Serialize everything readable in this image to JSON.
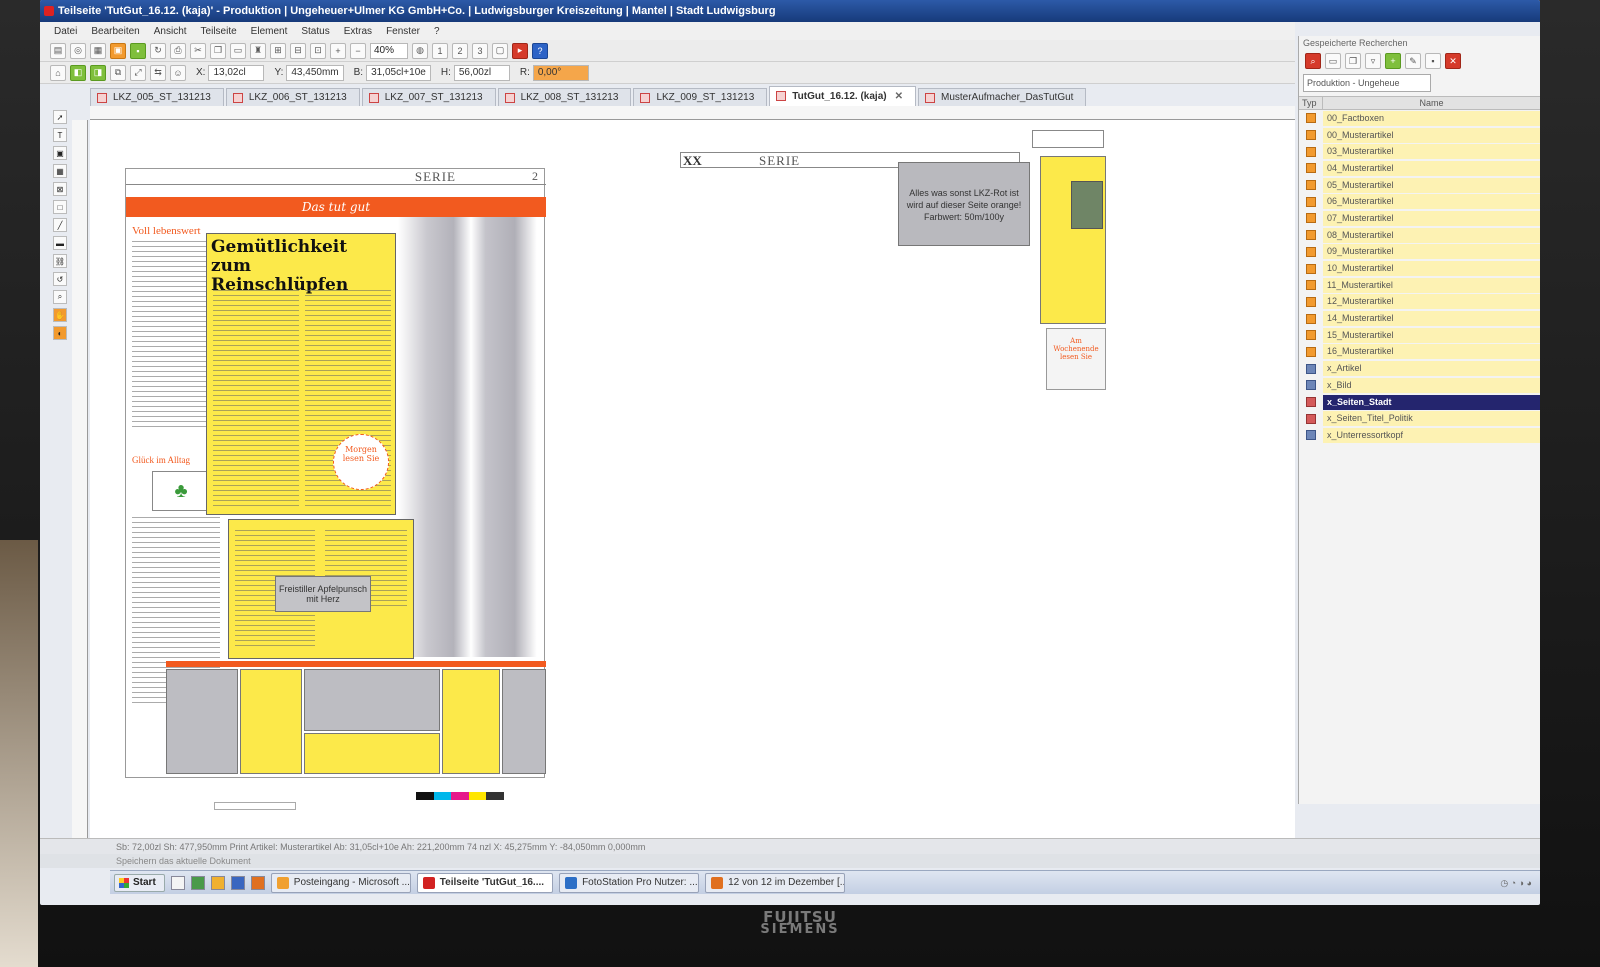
{
  "window": {
    "title": "Teilseite 'TutGut_16.12. (kaja)' - Produktion | Ungeheuer+Ulmer KG GmbH+Co. | Ludwigsburger Kreiszeitung | Mantel | Stadt Ludwigsburg"
  },
  "menu": [
    "Datei",
    "Bearbeiten",
    "Ansicht",
    "Teilseite",
    "Element",
    "Status",
    "Extras",
    "Fenster",
    "?"
  ],
  "toolbar": {
    "zoom": "40%",
    "x_label": "X:",
    "x_value": "13,02cl",
    "y_label": "Y:",
    "y_value": "43,450mm",
    "b_label": "B:",
    "b_value": "31,05cl+10e",
    "h_label": "H:",
    "h_value": "56,00zl",
    "r_label": "R:",
    "r_value": "0,00°"
  },
  "tabs": [
    {
      "label": "LKZ_005_ST_131213",
      "active": false
    },
    {
      "label": "LKZ_006_ST_131213",
      "active": false
    },
    {
      "label": "LKZ_007_ST_131213",
      "active": false
    },
    {
      "label": "LKZ_008_ST_131213",
      "active": false
    },
    {
      "label": "LKZ_009_ST_131213",
      "active": false
    },
    {
      "label": "TutGut_16.12. (kaja)",
      "active": true
    },
    {
      "label": "MusterAufmacher_DasTutGut",
      "active": false
    }
  ],
  "page": {
    "serie": "SERIE",
    "page_no": "2",
    "banner": "Das tut gut",
    "kicker": "Voll lebenswert",
    "headline_1": "Gemütlichkeit",
    "headline_2": "zum Reinschlüpfen",
    "stamp": "Morgen lesen Sie",
    "left_sub": "Glück im Alltag",
    "placeholder_text": "Freistiller Apfelpunsch mit Herz"
  },
  "page2": {
    "xx": "XX",
    "serie": "SERIE",
    "note": "Alles was sonst LKZ-Rot ist wird auf dieser Seite orange! Farbwert: 50m/100y",
    "stamp": "Am Wochenende lesen Sie"
  },
  "right_panel": {
    "title": "Gespeicherte Recherchen",
    "select": "Produktion - Ungeheue",
    "col_typ": "Typ",
    "col_name": "Name",
    "items": [
      {
        "label": "00_Factboxen",
        "type": "orange"
      },
      {
        "label": "00_Musterartikel",
        "type": "orange"
      },
      {
        "label": "03_Musterartikel",
        "type": "orange"
      },
      {
        "label": "04_Musterartikel",
        "type": "orange"
      },
      {
        "label": "05_Musterartikel",
        "type": "orange"
      },
      {
        "label": "06_Musterartikel",
        "type": "orange"
      },
      {
        "label": "07_Musterartikel",
        "type": "orange"
      },
      {
        "label": "08_Musterartikel",
        "type": "orange"
      },
      {
        "label": "09_Musterartikel",
        "type": "orange"
      },
      {
        "label": "10_Musterartikel",
        "type": "orange"
      },
      {
        "label": "11_Musterartikel",
        "type": "orange"
      },
      {
        "label": "12_Musterartikel",
        "type": "orange"
      },
      {
        "label": "14_Musterartikel",
        "type": "orange"
      },
      {
        "label": "15_Musterartikel",
        "type": "orange"
      },
      {
        "label": "16_Musterartikel",
        "type": "orange"
      },
      {
        "label": "x_Artikel",
        "type": "blue"
      },
      {
        "label": "x_Bild",
        "type": "blue"
      },
      {
        "label": "x_Seiten_Stadt",
        "type": "red",
        "selected": true
      },
      {
        "label": "x_Seiten_Titel_Politik",
        "type": "red"
      },
      {
        "label": "x_Unterressortkopf",
        "type": "blue"
      }
    ]
  },
  "status": {
    "line1": "Sb: 72,00zl   Sh: 477,950mm   Print Artikel: Musterartikel   Ab: 31,05cl+10e  Ah: 221,200mm  74 nzl   X: 45,275mm   Y: -84,050mm   0,000mm",
    "line2": "Speichern das aktuelle Dokument"
  },
  "taskbar": {
    "start": "Start",
    "items": [
      {
        "label": "Posteingang - Microsoft ...",
        "active": false,
        "color": "#f0a030"
      },
      {
        "label": "Teilseite 'TutGut_16....",
        "active": true,
        "color": "#d22222"
      },
      {
        "label": "FotoStation Pro  Nutzer: ...",
        "active": false,
        "color": "#2d6fc6"
      },
      {
        "label": "12 von 12 im Dezember [...",
        "active": false,
        "color": "#e07020"
      }
    ]
  },
  "colors": {
    "accent_orange": "#f25a1f",
    "layout_yellow": "#fce94a",
    "selection": "#24256e"
  },
  "brand": {
    "line1": "FUJITSU",
    "line2": "SIEMENS"
  }
}
